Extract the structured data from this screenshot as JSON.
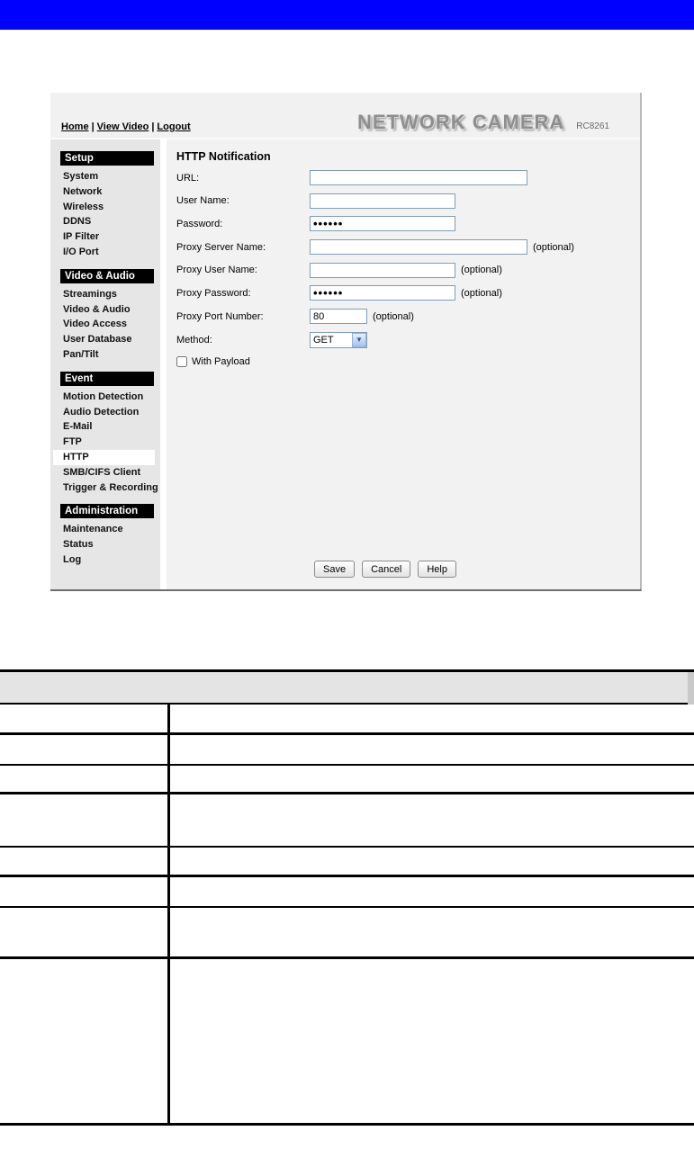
{
  "top_bar": {
    "color": "#0000ff"
  },
  "camera_ui": {
    "nav": {
      "links": [
        "Home",
        "View Video",
        "Logout"
      ],
      "separator": "|"
    },
    "brand": {
      "logo": "NETWORK CAMERA",
      "model": "RC8261"
    },
    "sidebar": {
      "sections": [
        {
          "title": "Setup",
          "items": [
            "System",
            "Network",
            "Wireless",
            "DDNS",
            "IP Filter",
            "I/O Port"
          ]
        },
        {
          "title": "Video & Audio",
          "items": [
            "Streamings",
            "Video & Audio",
            "Video Access",
            "User Database",
            "Pan/Tilt"
          ]
        },
        {
          "title": "Event",
          "items": [
            "Motion Detection",
            "Audio Detection",
            "E-Mail",
            "FTP",
            "HTTP",
            "SMB/CIFS Client",
            "Trigger & Recording"
          ]
        },
        {
          "title": "Administration",
          "items": [
            "Maintenance",
            "Status",
            "Log"
          ]
        }
      ],
      "selected": "HTTP"
    },
    "form": {
      "title": "HTTP Notification",
      "fields": [
        {
          "label": "URL:",
          "value": "",
          "optional": ""
        },
        {
          "label": "User Name:",
          "value": "",
          "optional": ""
        },
        {
          "label": "Password:",
          "value": "••••••",
          "optional": ""
        },
        {
          "label": "Proxy Server Name:",
          "value": "",
          "optional": "(optional)"
        },
        {
          "label": "Proxy User Name:",
          "value": "",
          "optional": "(optional)"
        },
        {
          "label": "Proxy Password:",
          "value": "••••••",
          "optional": "(optional)"
        },
        {
          "label": "Proxy Port Number:",
          "value": "80",
          "optional": "(optional)"
        }
      ],
      "method": {
        "label": "Method:",
        "value": "GET"
      },
      "payload_checkbox": {
        "label": "With Payload",
        "checked": false
      },
      "buttons": [
        "Save",
        "Cancel",
        "Help"
      ]
    }
  },
  "reference_table": {
    "header": "",
    "rows": [
      {
        "left": "",
        "right": ""
      },
      {
        "left": "",
        "right": ""
      },
      {
        "left": "",
        "right": ""
      },
      {
        "left": "",
        "right": ""
      },
      {
        "left": "",
        "right": ""
      },
      {
        "left": "",
        "right": ""
      },
      {
        "left": "",
        "right": ""
      },
      {
        "left": "",
        "right": ""
      }
    ]
  }
}
